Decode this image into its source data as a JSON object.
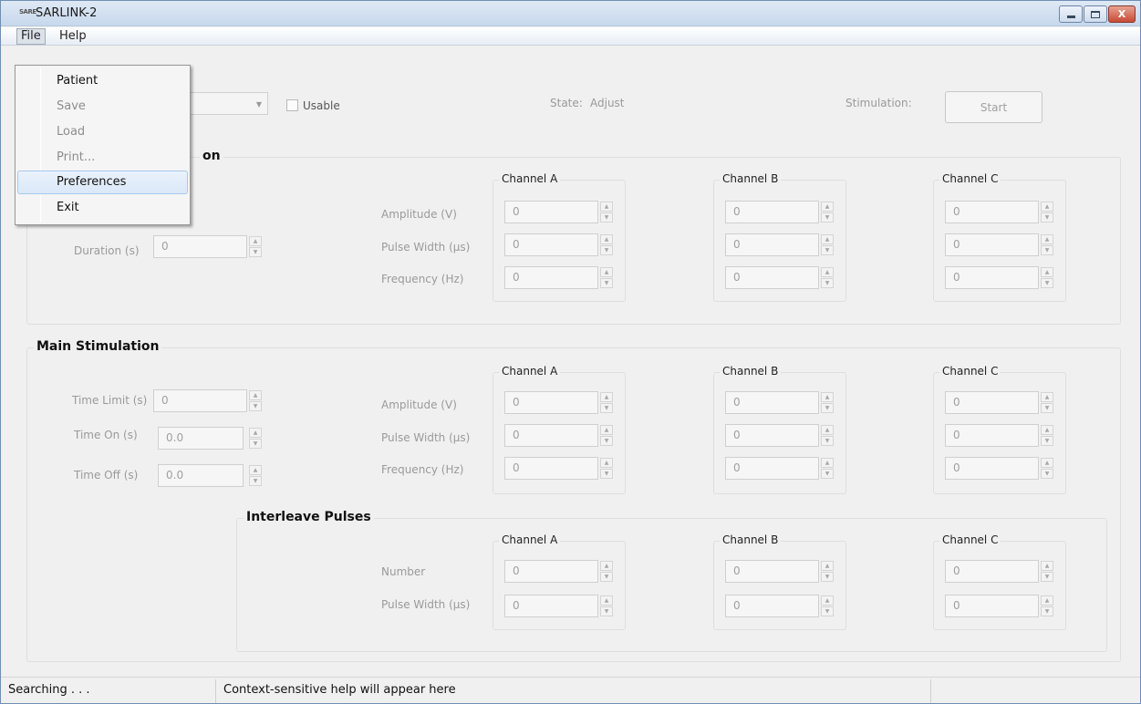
{
  "window": {
    "logo_text": "SARE",
    "title": "SARLINK-2",
    "buttons": {
      "minimize": "minimize",
      "maximize": "maximize",
      "close": "X"
    }
  },
  "menubar": {
    "file": "File",
    "help": "Help"
  },
  "file_menu": {
    "items": [
      {
        "label": "Patient",
        "enabled": true
      },
      {
        "label": "Save",
        "enabled": false
      },
      {
        "label": "Load",
        "enabled": false
      },
      {
        "label": "Print...",
        "enabled": false
      },
      {
        "label": "Preferences",
        "enabled": true,
        "highlighted": true
      },
      {
        "label": "Exit",
        "enabled": true
      }
    ]
  },
  "top_controls": {
    "usable_label": "Usable",
    "state_label": "State:",
    "state_value": "Adjust",
    "stimulation_label": "Stimulation:",
    "start_button": "Start"
  },
  "first_section": {
    "title_visible": "on",
    "duration_label": "Duration (s)",
    "duration_value": "0",
    "param_labels": [
      "Amplitude (V)",
      "Pulse Width (µs)",
      "Frequency (Hz)"
    ],
    "channels": [
      {
        "name": "Channel A",
        "values": [
          "0",
          "0",
          "0"
        ]
      },
      {
        "name": "Channel B",
        "values": [
          "0",
          "0",
          "0"
        ]
      },
      {
        "name": "Channel C",
        "values": [
          "0",
          "0",
          "0"
        ]
      }
    ]
  },
  "main_stimulation": {
    "title": "Main Stimulation",
    "time_limit_label": "Time Limit (s)",
    "time_limit_value": "0",
    "time_on_label": "Time On (s)",
    "time_on_value": "0.0",
    "time_off_label": "Time Off (s)",
    "time_off_value": "0.0",
    "param_labels": [
      "Amplitude (V)",
      "Pulse Width (µs)",
      "Frequency (Hz)"
    ],
    "channels": [
      {
        "name": "Channel A",
        "values": [
          "0",
          "0",
          "0"
        ]
      },
      {
        "name": "Channel B",
        "values": [
          "0",
          "0",
          "0"
        ]
      },
      {
        "name": "Channel C",
        "values": [
          "0",
          "0",
          "0"
        ]
      }
    ]
  },
  "interleave": {
    "title": "Interleave Pulses",
    "param_labels": [
      "Number",
      "Pulse Width (µs)"
    ],
    "channels": [
      {
        "name": "Channel A",
        "values": [
          "0",
          "0"
        ]
      },
      {
        "name": "Channel B",
        "values": [
          "0",
          "0"
        ]
      },
      {
        "name": "Channel C",
        "values": [
          "0",
          "0"
        ]
      }
    ]
  },
  "statusbar": {
    "status": "Searching . . .",
    "help_text": "Context-sensitive help will appear here",
    "extra": ""
  },
  "icons": {
    "spin_up": "up-arrow-icon",
    "spin_down": "down-arrow-icon",
    "combo": "chevron-down-icon"
  }
}
